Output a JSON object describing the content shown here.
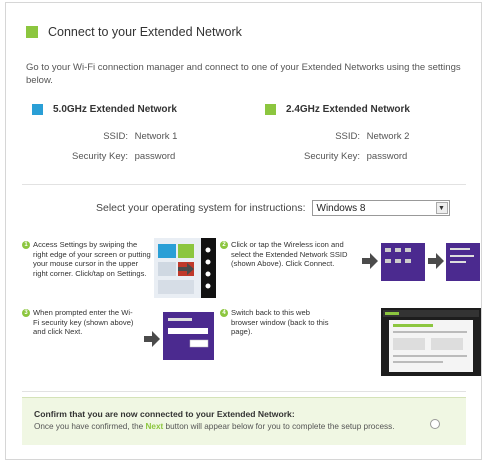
{
  "colors": {
    "green": "#8cc63f",
    "blue": "#2a9fd6",
    "purple": "#4b2a8f"
  },
  "header": {
    "title": "Connect to your Extended Network"
  },
  "description": "Go to your Wi-Fi connection manager and connect to one of your Extended Networks using the settings below.",
  "networks": [
    {
      "name": "5.0GHz Extended Network",
      "ssid_label": "SSID:",
      "ssid": "Network 1",
      "key_label": "Security Key:",
      "key": "password",
      "color": "#2a9fd6"
    },
    {
      "name": "2.4GHz Extended Network",
      "ssid_label": "SSID:",
      "ssid": "Network 2",
      "key_label": "Security Key:",
      "key": "password",
      "color": "#8cc63f"
    }
  ],
  "os_select": {
    "label": "Select your operating system for instructions:",
    "value": "Windows 8"
  },
  "steps": [
    {
      "num": "1",
      "text": "Access Settings by swiping the right edge of your screen or putting your mouse cursor in the upper right corner. Click/tap on Settings."
    },
    {
      "num": "2",
      "text": "Click or tap the Wireless icon and select the Extended Network SSID (shown Above). Click Connect."
    },
    {
      "num": "3",
      "text": "When prompted enter the Wi-Fi security key (shown above) and click Next."
    },
    {
      "num": "4",
      "text": "Switch back to this web browser window (back to this page)."
    }
  ],
  "confirm": {
    "title": "Confirm that you are now connected to your Extended Network:",
    "text_before": "Once you have confirmed, the ",
    "next_word": "Next",
    "text_after": " button will appear below for you to complete the setup process."
  }
}
